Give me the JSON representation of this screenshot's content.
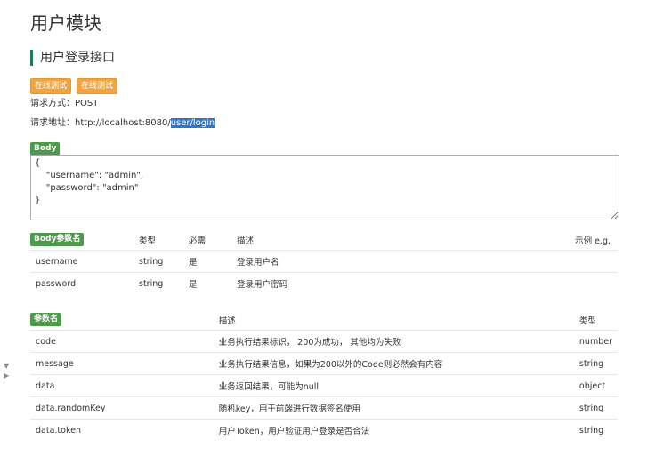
{
  "page": {
    "title": "用户模块",
    "section_title": "用户登录接口",
    "try_buttons": [
      "在线测试",
      "在线测试"
    ],
    "method_label": "请求方式：",
    "method_value": "POST",
    "url_label": "请求地址：",
    "url_base": "http://localhost:8080/",
    "url_path": "user/login",
    "body_label": "Body",
    "body_text": "{\n    \"username\": \"admin\",\n    \"password\": \"admin\"\n}"
  },
  "body_params": {
    "headers": [
      "Body参数名",
      "类型",
      "必需",
      "描述",
      "示例 e.g."
    ],
    "rows": [
      [
        "username",
        "string",
        "是",
        "登录用户名",
        ""
      ],
      [
        "password",
        "string",
        "是",
        "登录用户密码",
        ""
      ]
    ]
  },
  "response_params": {
    "headers": [
      "参数名",
      "描述",
      "类型"
    ],
    "rows": [
      [
        "code",
        "业务执行结果标识， 200为成功， 其他均为失败",
        "number"
      ],
      [
        "message",
        "业务执行结果信息，如果为200以外的Code则必然会有内容",
        "string"
      ],
      [
        "data",
        "业务返回结果，可能为null",
        "object"
      ],
      [
        "data.randomKey",
        "随机key，用于前端进行数据签名使用",
        "string"
      ],
      [
        "data.token",
        "用户Token，用户验证用户登录是否合法",
        "string"
      ]
    ]
  },
  "icons": {
    "collapse": "triangle-down-icon",
    "expand": "triangle-right-icon"
  },
  "colors": {
    "accent_green": "#4c9a4a",
    "try_orange": "#efa543",
    "highlight_blue": "#2f74d0",
    "section_bar": "#1e7a5c"
  }
}
